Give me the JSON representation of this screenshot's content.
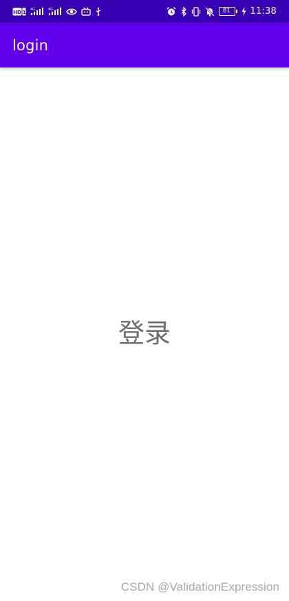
{
  "status_bar": {
    "icons_left": [
      "hd-icon",
      "signal-4g-icon",
      "signal-4g-icon",
      "eye-icon",
      "bilibili-icon",
      "usb-icon"
    ],
    "icons_right": [
      "alarm-icon",
      "bluetooth-icon",
      "vibrate-icon",
      "mute-icon"
    ],
    "battery_level": "81",
    "time": "11:38",
    "background": "#3700b3"
  },
  "app_bar": {
    "title": "login",
    "background": "#6200ee"
  },
  "main": {
    "login_text": "登录",
    "text_color": "#6e6e6e"
  },
  "watermark": {
    "text": "CSDN @ValidationExpression"
  }
}
